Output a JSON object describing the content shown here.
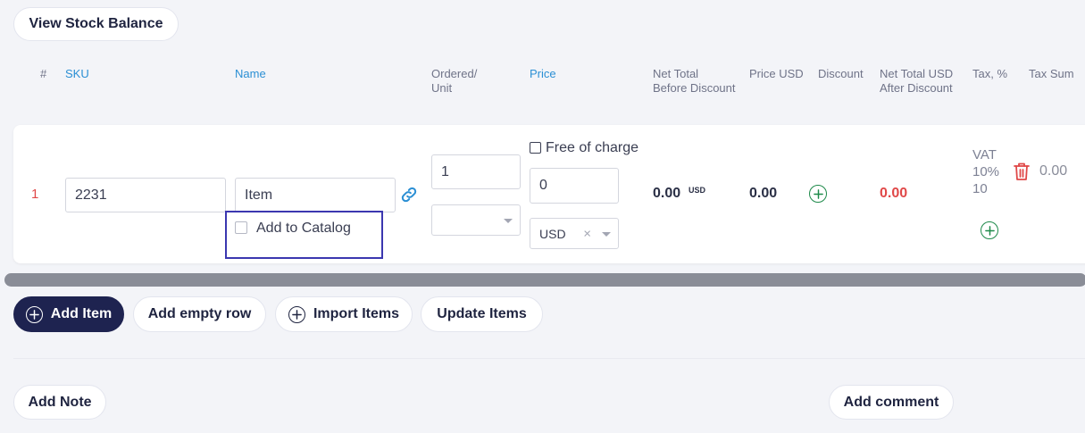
{
  "top": {
    "view_stock_balance": "View Stock Balance"
  },
  "columns": {
    "num": "#",
    "sku": "SKU",
    "name": "Name",
    "ordered_line1": "Ordered/",
    "ordered_line2": "Unit",
    "price": "Price",
    "net_total_line1": "Net Total",
    "net_total_line2": "Before Discount",
    "price_usd": "Price USD",
    "discount": "Discount",
    "net_total_usd_line1": "Net Total USD",
    "net_total_usd_line2": "After Discount",
    "tax_pct": "Tax, %",
    "tax_sum": "Tax Sum"
  },
  "row": {
    "index": "1",
    "sku_value": "2231",
    "name_value": "Item",
    "add_to_catalog_label": "Add to Catalog",
    "add_to_catalog_checked": false,
    "ordered_value": "1",
    "unit_value": "",
    "free_of_charge_label": "Free of charge",
    "free_of_charge_checked": false,
    "price_value": "0",
    "currency_value": "USD",
    "net_total_value": "0.00",
    "net_total_currency": "USD",
    "price_usd_value": "0.00",
    "net_total_usd_after_discount": "0.00",
    "tax_line1": "VAT",
    "tax_line2": "10%",
    "tax_line3": "10",
    "tax_sum_value": "0.00"
  },
  "actions": {
    "add_item": "Add Item",
    "add_empty_row": "Add empty row",
    "import_items": "Import Items",
    "update_items": "Update Items"
  },
  "footer": {
    "add_note": "Add Note",
    "add_comment": "Add comment"
  },
  "colors": {
    "accent_blue": "#2b8fd4",
    "dark_button": "#1e2350",
    "red_value": "#e04848",
    "green_icon": "#1e8a4a",
    "highlight_border": "#3b37b0"
  }
}
